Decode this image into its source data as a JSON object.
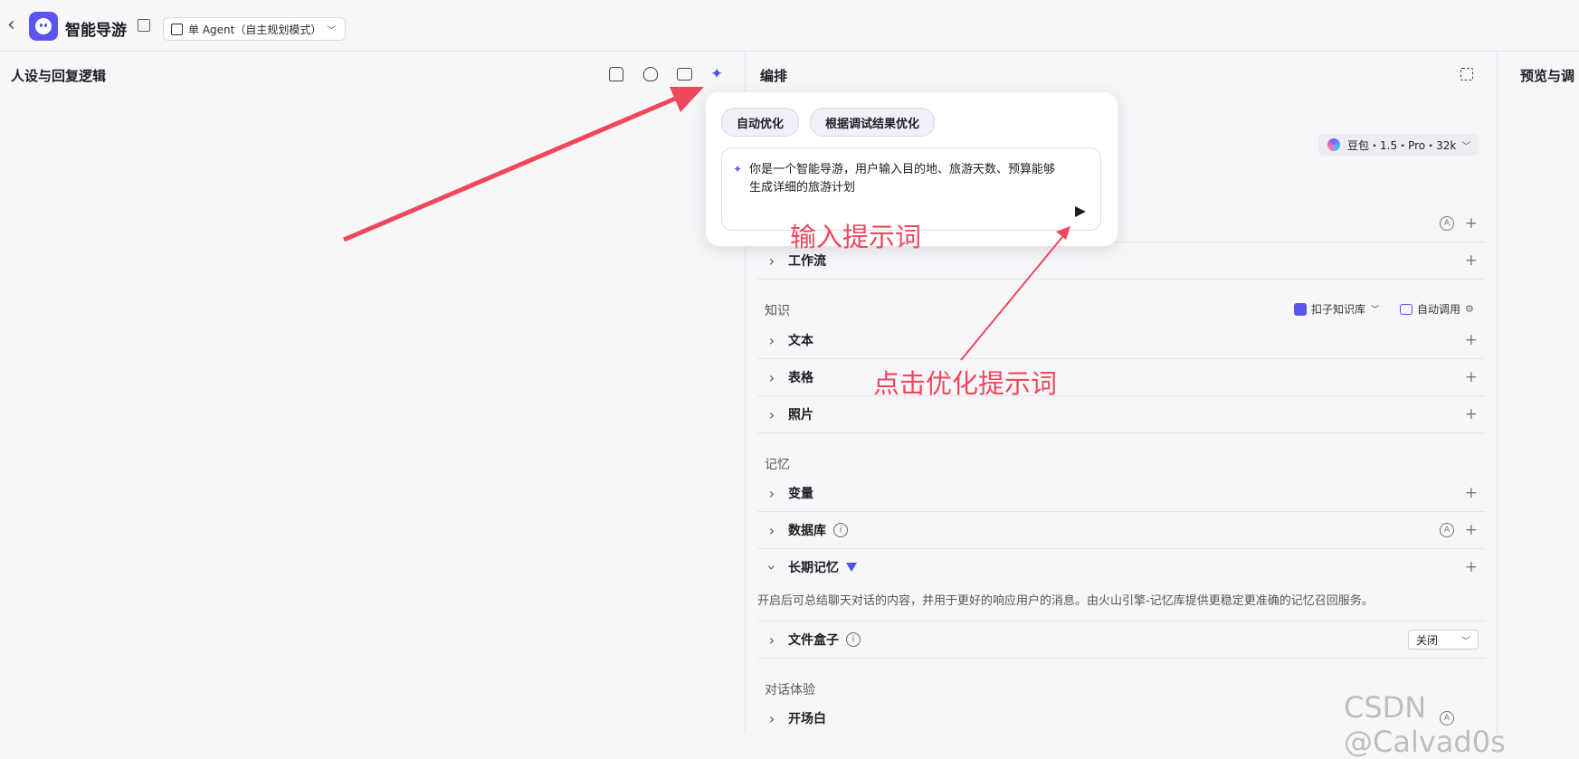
{
  "header": {
    "app_title": "智能导游",
    "mode_label": "单 Agent（自主规划模式）"
  },
  "left_panel": {
    "title": "人设与回复逻辑"
  },
  "middle_panel": {
    "title": "编排",
    "model": "豆包・1.5・Pro・32k",
    "rows": {
      "workflow": "工作流",
      "text": "文本",
      "table": "表格",
      "photo": "照片",
      "variable": "变量",
      "database": "数据库",
      "long_memory": "长期记忆",
      "file_box": "文件盒子",
      "opening": "开场白"
    },
    "sections": {
      "knowledge": "知识",
      "memory": "记忆",
      "dialog": "对话体验"
    },
    "knowledge_source": "扣子知识库",
    "auto_call": "自动调用",
    "long_memory_desc": "开启后可总结聊天对话的内容，并用于更好的响应用户的消息。由火山引擎-记忆库提供更稳定更准确的记忆召回服务。",
    "file_box_value": "关闭"
  },
  "right_panel": {
    "title": "预览与调"
  },
  "popover": {
    "chip_auto": "自动优化",
    "chip_debug": "根据调试结果优化",
    "prompt": "你是一个智能导游，用户输入目的地、旅游天数、预算能够生成详细的旅游计划"
  },
  "annotations": {
    "input_hint": "输入提示词",
    "click_hint": "点击优化提示词",
    "color": "#f0475c"
  },
  "watermark": "CSDN @Calvad0s"
}
